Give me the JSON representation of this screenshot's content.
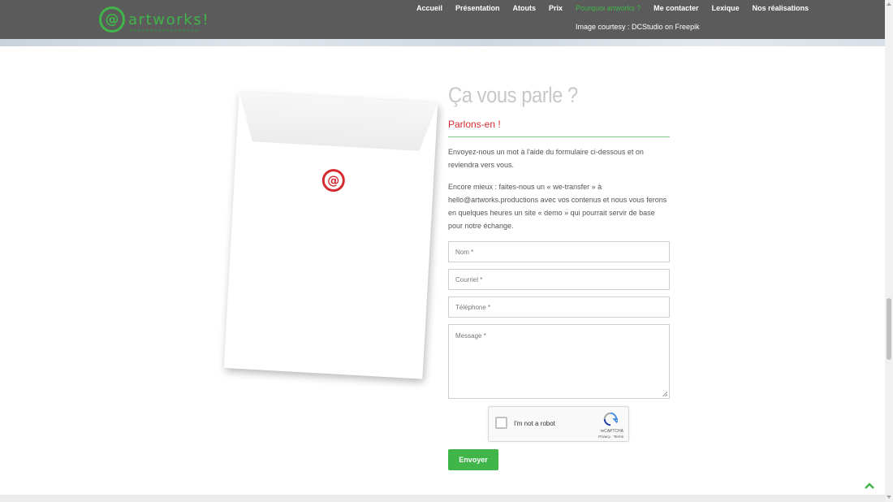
{
  "header": {
    "logo_mark": "@",
    "logo_text": "artworks!",
    "nav": [
      {
        "label": "Accueil"
      },
      {
        "label": "Présentation"
      },
      {
        "label": "Atouts"
      },
      {
        "label": "Prix"
      },
      {
        "label": "Pourquoi artworks ?",
        "active": true
      },
      {
        "label": "Me contacter"
      },
      {
        "label": "Lexique"
      },
      {
        "label": "Nos réalisations"
      }
    ],
    "courtesy": "Image courtesy : DCStudio on Freepik"
  },
  "envelope": {
    "logo_mark": "@"
  },
  "content": {
    "title": "Ça vous parle ?",
    "subtitle": "Parlons-en !",
    "paragraph1": "Envoyez-nous un mot à l'aide du formulaire ci-dessous et on reviendra vers vous.",
    "paragraph2": "Encore mieux : faites-nous un « we-transfer » à hello@artworks.productions avec vos contenus et nous vous ferons en quelques heures un site « demo » qui pourrait servir de base pour notre échange."
  },
  "form": {
    "name_placeholder": "Nom *",
    "email_placeholder": "Courriel *",
    "phone_placeholder": "Téléphone *",
    "message_placeholder": "Message *",
    "submit_label": "Envoyer"
  },
  "captcha": {
    "label": "I'm not a robot",
    "brand": "reCAPTCHA",
    "links": "Privacy - Terms"
  },
  "colors": {
    "accent_green": "#3fb54a",
    "accent_red": "#d42a2f",
    "header_bg": "#5b5b5b"
  },
  "icons": {
    "scroll_top": "chevron-up-icon",
    "captcha": "recaptcha-icon"
  }
}
